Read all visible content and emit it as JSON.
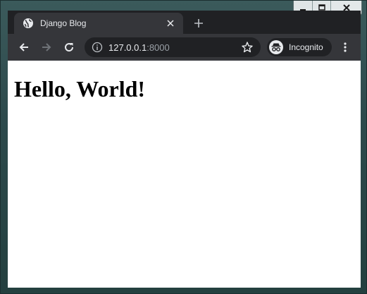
{
  "window": {
    "controls": [
      "minimize",
      "maximize",
      "close"
    ]
  },
  "tab": {
    "title": "Django Blog",
    "favicon": "globe-icon"
  },
  "toolbar": {
    "back_icon": "back-arrow-icon",
    "forward_icon": "forward-arrow-icon",
    "reload_icon": "reload-icon",
    "url_host": "127.0.0.1",
    "url_port": ":8000",
    "incognito_label": "Incognito"
  },
  "page": {
    "heading": "Hello, World!"
  },
  "colors": {
    "tabstrip_bg": "#202124",
    "toolbar_bg": "#35363a",
    "text_light": "#e8eaed",
    "text_dim": "#9aa0a6"
  }
}
